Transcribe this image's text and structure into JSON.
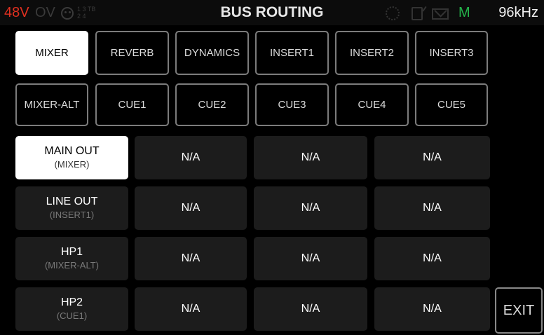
{
  "status": {
    "phantom": "48V",
    "overload": "OV",
    "pad_top": "1 3 TB",
    "pad_bottom": "2 4",
    "title": "BUS ROUTING",
    "m_indicator": "M",
    "sample_rate": "96kHz",
    "icons": [
      "pad-icon",
      "gear-icon",
      "sdcard-icon",
      "mail-icon"
    ],
    "colors": {
      "phantom": "#e03020",
      "m_indicator": "#24b24a",
      "inactive": "#3a3a3a"
    }
  },
  "buses": {
    "row1": [
      "MIXER",
      "REVERB",
      "DYNAMICS",
      "INSERT1",
      "INSERT2",
      "INSERT3"
    ],
    "row2": [
      "MIXER-ALT",
      "CUE1",
      "CUE2",
      "CUE3",
      "CUE4",
      "CUE5"
    ],
    "selected": "MIXER"
  },
  "outputs": [
    {
      "name": "MAIN OUT",
      "source": "(MIXER)",
      "cols": [
        "N/A",
        "N/A",
        "N/A"
      ],
      "selected": true
    },
    {
      "name": "LINE OUT",
      "source": "(INSERT1)",
      "cols": [
        "N/A",
        "N/A",
        "N/A"
      ]
    },
    {
      "name": "HP1",
      "source": "(MIXER-ALT)",
      "cols": [
        "N/A",
        "N/A",
        "N/A"
      ]
    },
    {
      "name": "HP2",
      "source": "(CUE1)",
      "cols": [
        "N/A",
        "N/A",
        "N/A"
      ]
    }
  ],
  "exit_label": "EXIT"
}
